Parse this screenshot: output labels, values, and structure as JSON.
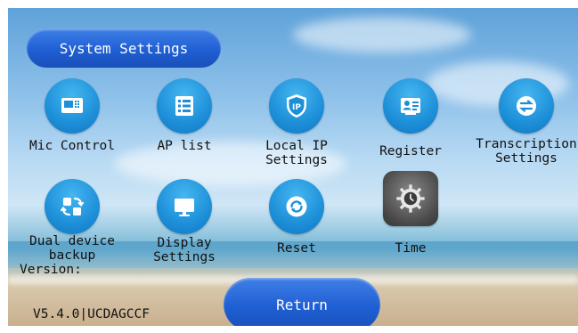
{
  "header": {
    "title": "System Settings"
  },
  "tiles": [
    {
      "label": "Mic Control",
      "icon": "mic-control-icon"
    },
    {
      "label": "AP list",
      "icon": "list-icon"
    },
    {
      "label": "Local IP\nSettings",
      "icon": "ip-shield-icon"
    },
    {
      "label": "Register",
      "icon": "id-card-icon"
    },
    {
      "label": "Transcription\nSettings",
      "icon": "transcription-icon"
    },
    {
      "label": "Dual device\nbackup",
      "icon": "dual-device-backup-icon"
    },
    {
      "label": "Display\nSettings",
      "icon": "monitor-icon"
    },
    {
      "label": "Reset",
      "icon": "reset-icon"
    },
    {
      "label": "Time",
      "icon": "gear-clock-icon"
    }
  ],
  "version": {
    "label": "Version:",
    "value": "V5.4.0|UCDAGCCF"
  },
  "footer": {
    "return_label": "Return"
  },
  "colors": {
    "button_blue": "#1f5fd4",
    "icon_blue": "#1d8fd8",
    "time_gray": "#4a4a4a"
  }
}
